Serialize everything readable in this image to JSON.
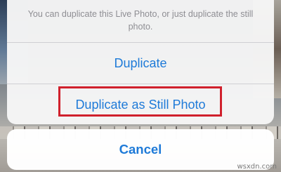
{
  "action_sheet": {
    "message": "You can duplicate this Live Photo, or just duplicate the still photo.",
    "options": [
      {
        "label": "Duplicate"
      },
      {
        "label": "Duplicate as Still Photo"
      }
    ],
    "cancel_label": "Cancel"
  },
  "colors": {
    "action_text": "#1e7ad8",
    "message_text": "#8e8e93",
    "highlight_border": "#d0202c"
  },
  "watermark": "wsxdn.com"
}
